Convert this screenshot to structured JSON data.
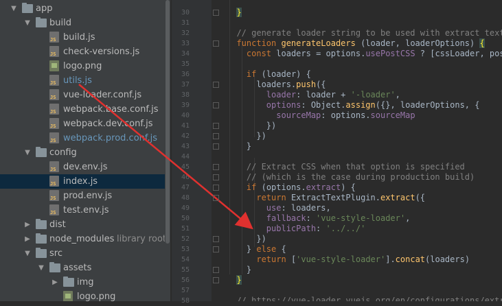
{
  "tree": {
    "items": [
      {
        "label": "app",
        "kind": "folder",
        "arrow": "open",
        "hint": ""
      },
      {
        "label": "build",
        "kind": "folder",
        "arrow": "open",
        "hint": ""
      },
      {
        "label": "build.js",
        "kind": "js",
        "arrow": "",
        "hint": ""
      },
      {
        "label": "check-versions.js",
        "kind": "js",
        "arrow": "",
        "hint": ""
      },
      {
        "label": "logo.png",
        "kind": "png",
        "arrow": "",
        "hint": ""
      },
      {
        "label": "utils.js",
        "kind": "js",
        "arrow": "",
        "hint": "",
        "modified": true
      },
      {
        "label": "vue-loader.conf.js",
        "kind": "js",
        "arrow": "",
        "hint": ""
      },
      {
        "label": "webpack.base.conf.js",
        "kind": "js",
        "arrow": "",
        "hint": ""
      },
      {
        "label": "webpack.dev.conf.js",
        "kind": "js",
        "arrow": "",
        "hint": ""
      },
      {
        "label": "webpack.prod.conf.js",
        "kind": "js",
        "arrow": "",
        "hint": "",
        "modified": true
      },
      {
        "label": "config",
        "kind": "folder",
        "arrow": "open",
        "hint": ""
      },
      {
        "label": "dev.env.js",
        "kind": "js",
        "arrow": "",
        "hint": ""
      },
      {
        "label": "index.js",
        "kind": "js",
        "arrow": "",
        "hint": "",
        "selected": true
      },
      {
        "label": "prod.env.js",
        "kind": "js",
        "arrow": "",
        "hint": ""
      },
      {
        "label": "test.env.js",
        "kind": "js",
        "arrow": "",
        "hint": ""
      },
      {
        "label": "dist",
        "kind": "folder",
        "arrow": "closed",
        "hint": ""
      },
      {
        "label": "node_modules",
        "kind": "folder",
        "arrow": "closed",
        "hint": "library root"
      },
      {
        "label": "src",
        "kind": "folder",
        "arrow": "open",
        "hint": ""
      },
      {
        "label": "assets",
        "kind": "folder",
        "arrow": "open",
        "hint": ""
      },
      {
        "label": "img",
        "kind": "folder",
        "arrow": "closed",
        "hint": ""
      },
      {
        "label": "logo.png",
        "kind": "png",
        "arrow": "",
        "hint": ""
      }
    ]
  },
  "editor": {
    "line_numbers": [
      "30",
      "31",
      "32",
      "33",
      "34",
      "35",
      "36",
      "37",
      "38",
      "39",
      "40",
      "41",
      "42",
      "43",
      "44",
      "45",
      "46",
      "47",
      "48",
      "49",
      "50",
      "51",
      "52",
      "53",
      "54",
      "55",
      "56",
      "57",
      "58"
    ],
    "lines": [
      [
        {
          "t": "  "
        },
        {
          "t": "}",
          "c": "brace"
        }
      ],
      [],
      [
        {
          "t": "  // generate loader string to be used with extract text pl",
          "c": "c"
        }
      ],
      [
        {
          "t": "  "
        },
        {
          "t": "function ",
          "c": "k"
        },
        {
          "t": "generateLoaders",
          "c": "f"
        },
        {
          "t": " (loader, loaderOptions) "
        },
        {
          "t": "{",
          "c": "brace"
        }
      ],
      [
        {
          "t": "    "
        },
        {
          "t": "const ",
          "c": "k"
        },
        {
          "t": "loaders = options."
        },
        {
          "t": "usePostCSS",
          "c": "p"
        },
        {
          "t": " ? [cssLoader, postcs"
        }
      ],
      [],
      [
        {
          "t": "    "
        },
        {
          "t": "if ",
          "c": "k"
        },
        {
          "t": "(loader) {"
        }
      ],
      [
        {
          "t": "      loaders."
        },
        {
          "t": "push",
          "c": "f"
        },
        {
          "t": "({"
        }
      ],
      [
        {
          "t": "        "
        },
        {
          "t": "loader",
          "c": "p"
        },
        {
          "t": ": loader + "
        },
        {
          "t": "'-loader'",
          "c": "s"
        },
        {
          "t": ","
        }
      ],
      [
        {
          "t": "        "
        },
        {
          "t": "options",
          "c": "p"
        },
        {
          "t": ": Object."
        },
        {
          "t": "assign",
          "c": "f"
        },
        {
          "t": "({}, loaderOptions, {"
        }
      ],
      [
        {
          "t": "          "
        },
        {
          "t": "sourceMap",
          "c": "p"
        },
        {
          "t": ": options."
        },
        {
          "t": "sourceMap",
          "c": "p"
        }
      ],
      [
        {
          "t": "        })"
        }
      ],
      [
        {
          "t": "      })"
        }
      ],
      [
        {
          "t": "    }"
        }
      ],
      [],
      [
        {
          "t": "    // Extract CSS when that option is specified",
          "c": "c"
        }
      ],
      [
        {
          "t": "    // (which is the case during production build)",
          "c": "c"
        }
      ],
      [
        {
          "t": "    "
        },
        {
          "t": "if ",
          "c": "k"
        },
        {
          "t": "(options."
        },
        {
          "t": "extract",
          "c": "p"
        },
        {
          "t": ") {"
        }
      ],
      [
        {
          "t": "      "
        },
        {
          "t": "return ",
          "c": "k"
        },
        {
          "t": "ExtractTextPlugin."
        },
        {
          "t": "extract",
          "c": "f"
        },
        {
          "t": "({"
        }
      ],
      [
        {
          "t": "        "
        },
        {
          "t": "use",
          "c": "p"
        },
        {
          "t": ": loaders,"
        }
      ],
      [
        {
          "t": "        "
        },
        {
          "t": "fallback",
          "c": "p"
        },
        {
          "t": ": "
        },
        {
          "t": "'vue-style-loader'",
          "c": "s"
        },
        {
          "t": ","
        }
      ],
      [
        {
          "t": "        "
        },
        {
          "t": "publicPath",
          "c": "p"
        },
        {
          "t": ": "
        },
        {
          "t": "'../../'",
          "c": "s"
        }
      ],
      [
        {
          "t": "      })"
        }
      ],
      [
        {
          "t": "    } "
        },
        {
          "t": "else ",
          "c": "k"
        },
        {
          "t": "{"
        }
      ],
      [
        {
          "t": "      "
        },
        {
          "t": "return ",
          "c": "k"
        },
        {
          "t": "["
        },
        {
          "t": "'vue-style-loader'",
          "c": "s"
        },
        {
          "t": "]."
        },
        {
          "t": "concat",
          "c": "f"
        },
        {
          "t": "(loaders)"
        }
      ],
      [
        {
          "t": "    }"
        }
      ],
      [
        {
          "t": "  "
        },
        {
          "t": "}",
          "c": "brace"
        }
      ],
      [],
      [
        {
          "t": "  // https://vue-loader.vuejs.org/en/configurations/extract",
          "c": "c"
        }
      ]
    ]
  },
  "colors": {
    "annotation_arrow": "#e0312f",
    "selection": "#0d293e",
    "background": "#2b2b2b"
  }
}
